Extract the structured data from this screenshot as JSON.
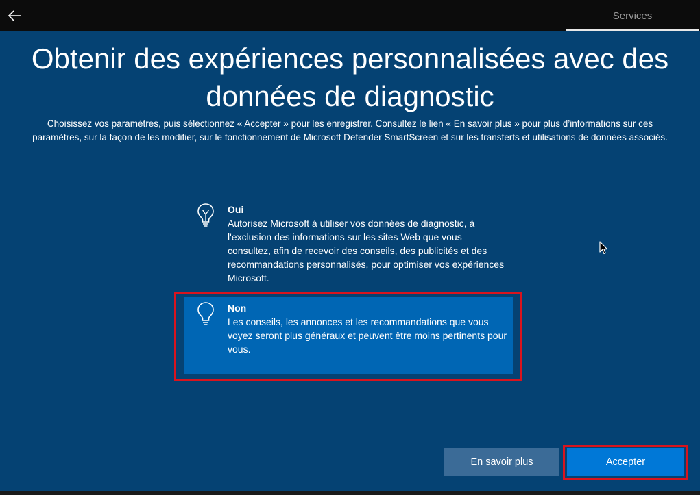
{
  "topbar": {
    "back_icon": "arrow-left-icon",
    "tab_label": "Services"
  },
  "main": {
    "title": "Obtenir des expériences personnalisées avec des données de diagnostic",
    "subtitle": "Choisissez vos paramètres, puis sélectionnez « Accepter » pour les enregistrer. Consultez le lien « En savoir plus » pour plus d’informations sur ces paramètres, sur la façon de les modifier, sur le fonctionnement de Microsoft Defender SmartScreen et sur les transferts et utilisations de données associés.",
    "options": [
      {
        "title": "Oui",
        "description": "Autorisez Microsoft à utiliser vos données de diagnostic, à l'exclusion des informations sur les sites Web que vous consultez, afin de recevoir des conseils, des publicités et des recommandations personnalisés, pour optimiser vos expériences Microsoft.",
        "icon": "lightbulb-on-icon",
        "selected": false
      },
      {
        "title": "Non",
        "description": "Les conseils, les annonces et les recommandations que vous voyez seront plus généraux et peuvent être moins pertinents pour vous.",
        "icon": "lightbulb-off-icon",
        "selected": true
      }
    ]
  },
  "buttons": {
    "learn_more": "En savoir plus",
    "accept": "Accepter"
  },
  "colors": {
    "background": "#054273",
    "selected_option": "#0066b4",
    "accept_button": "#0078d7",
    "secondary_button": "#3b6b97",
    "annotation_highlight": "#d9141e"
  }
}
